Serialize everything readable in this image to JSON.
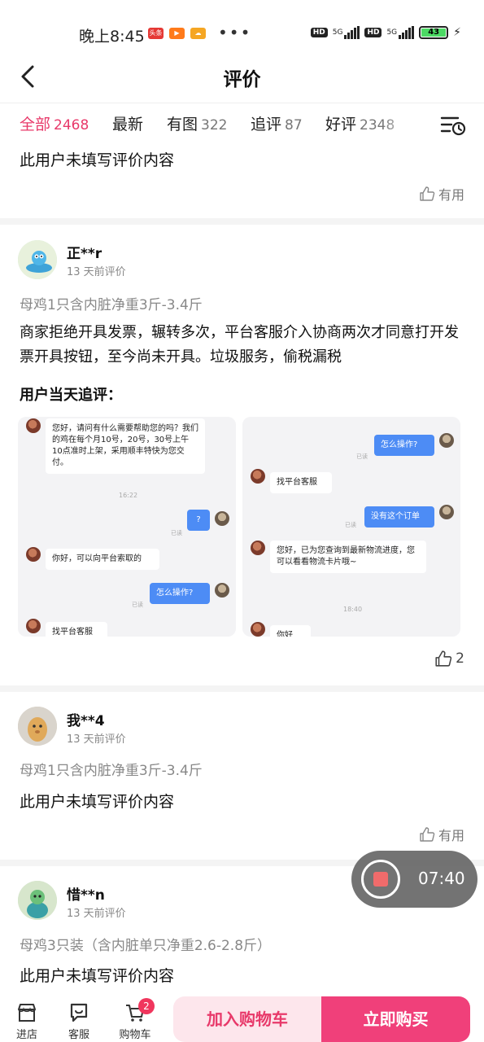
{
  "status_bar": {
    "time": "晚上8:45",
    "badge_toutiao": "头条",
    "battery": "43",
    "network_label": "5G",
    "hd_label": "HD"
  },
  "nav": {
    "title": "评价"
  },
  "filters": [
    {
      "label": "全部",
      "count": "2468",
      "active": true
    },
    {
      "label": "最新",
      "count": ""
    },
    {
      "label": "有图",
      "count": "322"
    },
    {
      "label": "追评",
      "count": "87"
    },
    {
      "label": "好评",
      "count": "2348"
    }
  ],
  "review0": {
    "text": "此用户未填写评价内容",
    "useful_label": "有用"
  },
  "review1": {
    "user": "正**r",
    "time": "13 天前评价",
    "spec": "母鸡1只含内脏净重3斤-3.4斤",
    "text": "商家拒绝开具发票，辗转多次，平台客服介入协商两次才同意打开发票开具按钮，至今尚未开具。垃圾服务，偷税漏税",
    "followup_label": "用户当天追评：",
    "likes": "2",
    "shot1": {
      "msg1": "您好，请问有什么需要帮助您的吗？我们的鸡在每个月10号，20号，30号上午10点准时上架，采用顺丰特快为您交付。",
      "time1": "16:22",
      "msg2": "?",
      "read1": "已读",
      "msg3": "你好，可以向平台索取的",
      "msg4": "怎么操作?",
      "read2": "已读",
      "msg5": "找平台客服"
    },
    "shot2": {
      "msg1": "怎么操作?",
      "read1": "已读",
      "msg2": "找平台客服",
      "msg3": "没有这个订单",
      "read2": "已读",
      "msg4": "您好，已为您查询到最新物流进度，您可以看看物流卡片哦~",
      "time1": "18:40",
      "msg5": "你好"
    }
  },
  "review2": {
    "user": "我**4",
    "time": "13 天前评价",
    "spec": "母鸡1只含内脏净重3斤-3.4斤",
    "text": "此用户未填写评价内容",
    "useful_label": "有用"
  },
  "review3": {
    "user": "惜**n",
    "time": "13 天前评价",
    "spec": "母鸡3只装（含内脏单只净重2.6-2.8斤）",
    "text": "此用户未填写评价内容"
  },
  "recorder": {
    "time": "07:40"
  },
  "bottom": {
    "store": "进店",
    "service": "客服",
    "cart": "购物车",
    "cart_count": "2",
    "add_cart": "加入购物车",
    "buy_now": "立即购买"
  },
  "colors": {
    "accent": "#e8396a",
    "buy_button": "#f0407a",
    "cart_button_bg": "#fde6ec",
    "chat_blue": "#4d8cf5"
  }
}
